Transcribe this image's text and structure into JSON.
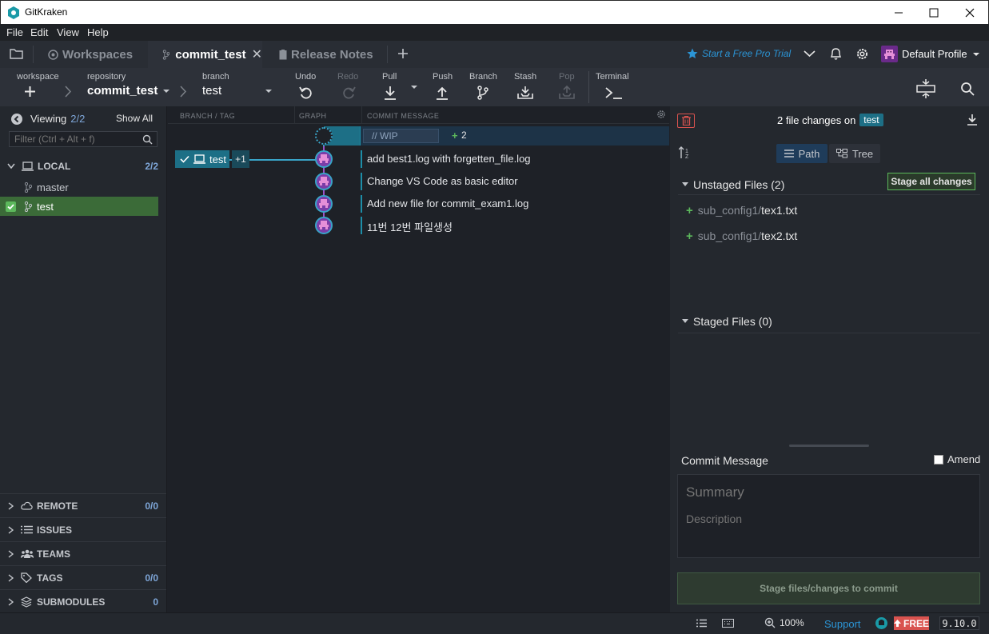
{
  "app": {
    "title": "GitKraken"
  },
  "menu": [
    "File",
    "Edit",
    "View",
    "Help"
  ],
  "tabs": {
    "workspaces": "Workspaces",
    "active": "commit_test",
    "release_notes": "Release Notes"
  },
  "header_right": {
    "trial": "Start a Free Pro Trial",
    "profile": "Default Profile"
  },
  "toolbar": {
    "workspace_label": "workspace",
    "repository_label": "repository",
    "repository_value": "commit_test",
    "branch_label": "branch",
    "branch_value": "test",
    "undo": "Undo",
    "redo": "Redo",
    "pull": "Pull",
    "push": "Push",
    "branch_btn": "Branch",
    "stash": "Stash",
    "pop": "Pop",
    "terminal": "Terminal"
  },
  "left": {
    "viewing": "Viewing",
    "viewing_count": "2/2",
    "show_all": "Show All",
    "filter_placeholder": "Filter (Ctrl + Alt + f)",
    "local_label": "LOCAL",
    "local_count": "2/2",
    "branches": [
      "master",
      "test"
    ],
    "sections": [
      {
        "label": "REMOTE",
        "count": "0/0"
      },
      {
        "label": "ISSUES",
        "count": ""
      },
      {
        "label": "TEAMS",
        "count": ""
      },
      {
        "label": "TAGS",
        "count": "0/0"
      },
      {
        "label": "SUBMODULES",
        "count": "0"
      }
    ]
  },
  "graph": {
    "col_branch": "BRANCH / TAG",
    "col_graph": "GRAPH",
    "col_msg": "COMMIT MESSAGE",
    "wip": "// WIP",
    "wip_count": "2",
    "branch_tag": "test",
    "branch_extra": "+1",
    "commits": [
      "add best1.log with forgetten_file.log",
      "Change VS Code as basic editor",
      "Add new file for commit_exam1.log",
      "11번 12번 파일생성"
    ]
  },
  "right": {
    "changes_text": "2 file changes on",
    "branch_badge": "test",
    "path": "Path",
    "tree": "Tree",
    "unstaged_title": "Unstaged Files (2)",
    "stage_all": "Stage all changes",
    "unstaged_files": [
      {
        "dir": "sub_config1/",
        "name": "tex1.txt"
      },
      {
        "dir": "sub_config1/",
        "name": "tex2.txt"
      }
    ],
    "staged_title": "Staged Files (0)",
    "commit_message": "Commit Message",
    "amend": "Amend",
    "summary_placeholder": "Summary",
    "description_placeholder": "Description",
    "stage_button": "Stage files/changes to commit"
  },
  "status": {
    "zoom": "100%",
    "support": "Support",
    "free": "FREE",
    "version": "9.10.0"
  },
  "colors": {
    "accent": "#1d8ea8",
    "node": "#7a3ea8",
    "green": "#5cb85c",
    "free": "#d9534f"
  }
}
